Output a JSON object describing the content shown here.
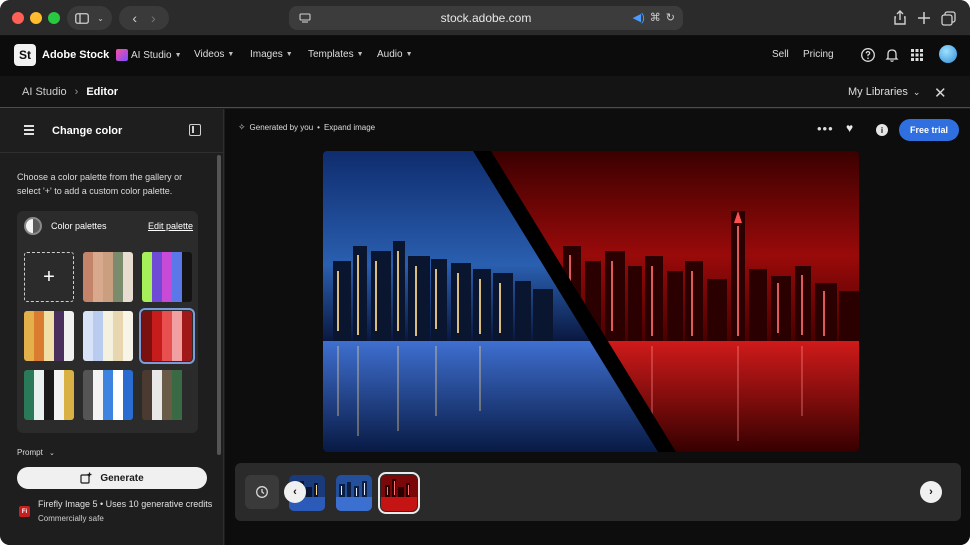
{
  "browser": {
    "url": "stock.adobe.com"
  },
  "header": {
    "logo_mark": "St",
    "brand": "Adobe Stock",
    "nav": [
      {
        "label": "AI Studio"
      },
      {
        "label": "Videos"
      },
      {
        "label": "Images"
      },
      {
        "label": "Templates"
      },
      {
        "label": "Audio"
      }
    ],
    "sell": "Sell",
    "pricing": "Pricing"
  },
  "breadcrumb": {
    "parent": "AI Studio",
    "current": "Editor",
    "libraries": "My Libraries"
  },
  "panel": {
    "title": "Change color",
    "description": "Choose a color palette from the gallery or select '+' to add a custom color palette.",
    "palettes_label": "Color palettes",
    "edit_palette": "Edit palette",
    "add_symbol": "+",
    "prompt_label": "Prompt",
    "generate_label": "Generate",
    "model_badge": "Fi",
    "model_info": "Firefly Image 5 • Uses 10 generative credits",
    "model_sub": "Commercially safe"
  },
  "palettes": [
    {
      "colors": [
        "#c4846a",
        "#d9a98e",
        "#c99f80",
        "#7b8c6e",
        "#e8ddd0"
      ]
    },
    {
      "colors": [
        "#a6f05a",
        "#6e4ad6",
        "#c84bd8",
        "#5b78e8",
        "#141414"
      ]
    },
    {
      "colors": [
        "#e3b04a",
        "#d97c2f",
        "#f1dfa8",
        "#4a2f5c",
        "#f0f0f0"
      ]
    },
    {
      "colors": [
        "#d9e3f7",
        "#b9cbee",
        "#f4f1df",
        "#e8d6b0",
        "#f7f4e8"
      ]
    },
    {
      "colors": [
        "#7a1010",
        "#c61c1c",
        "#e85050",
        "#f0a0a0",
        "#a01818"
      ]
    },
    {
      "colors": [
        "#2a7a5a",
        "#e8f0f0",
        "#1a1a1a",
        "#f2f2f2",
        "#d8b044"
      ]
    },
    {
      "colors": [
        "#555555",
        "#f4f4f4",
        "#3d84e0",
        "#ffffff",
        "#2a6cd0"
      ]
    },
    {
      "colors": [
        "#4a3a30",
        "#e8e8e8",
        "#6a5a48",
        "#3a6a44",
        "#2a2a2a"
      ]
    }
  ],
  "toolbar": {
    "generated_by": "Generated by you",
    "separator": "•",
    "expand": "Expand image",
    "free_trial": "Free trial"
  },
  "colors": {
    "accent": "#2f6fe0",
    "selected_palette_outline": "#7d9bd6",
    "header_divider": "#7a3a3a"
  }
}
